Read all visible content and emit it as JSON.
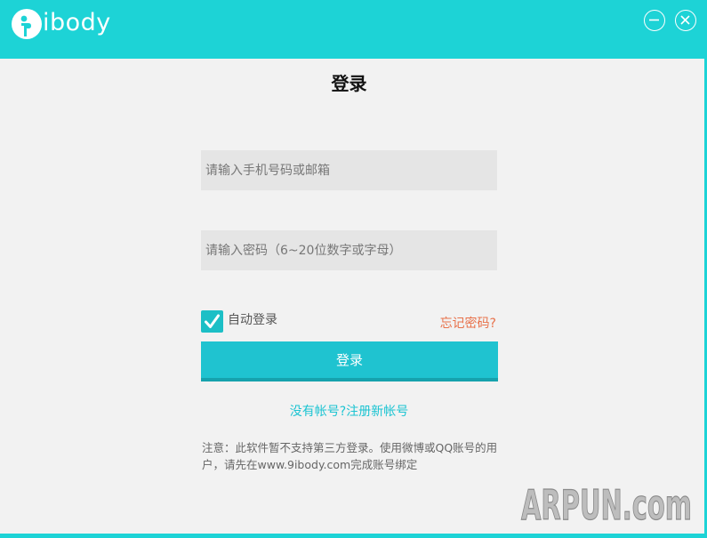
{
  "app": {
    "logo_text": "ibody",
    "colors": {
      "brand": "#1dd3d6",
      "button": "#1fc3d0",
      "link": "#1cc4d2",
      "forgot": "#e8714a",
      "background": "#f2f2f2",
      "field": "#e5e5e5"
    }
  },
  "window_controls": {
    "minimize_icon": "minus-circle-icon",
    "close_icon": "x-circle-icon"
  },
  "login": {
    "title": "登录",
    "account_placeholder": "请输入手机号码或邮箱",
    "password_placeholder": "请输入密码（6~20位数字或字母）",
    "auto_login_label": "自动登录",
    "auto_login_checked": true,
    "forgot_password": "忘记密码?",
    "submit_label": "登录",
    "register_link": "没有帐号?注册新帐号",
    "notice": "注意：此软件暂不支持第三方登录。使用微博或QQ账号的用户，请先在www.9ibody.com完成账号绑定"
  },
  "watermark": {
    "text": "ARPUN.com"
  }
}
